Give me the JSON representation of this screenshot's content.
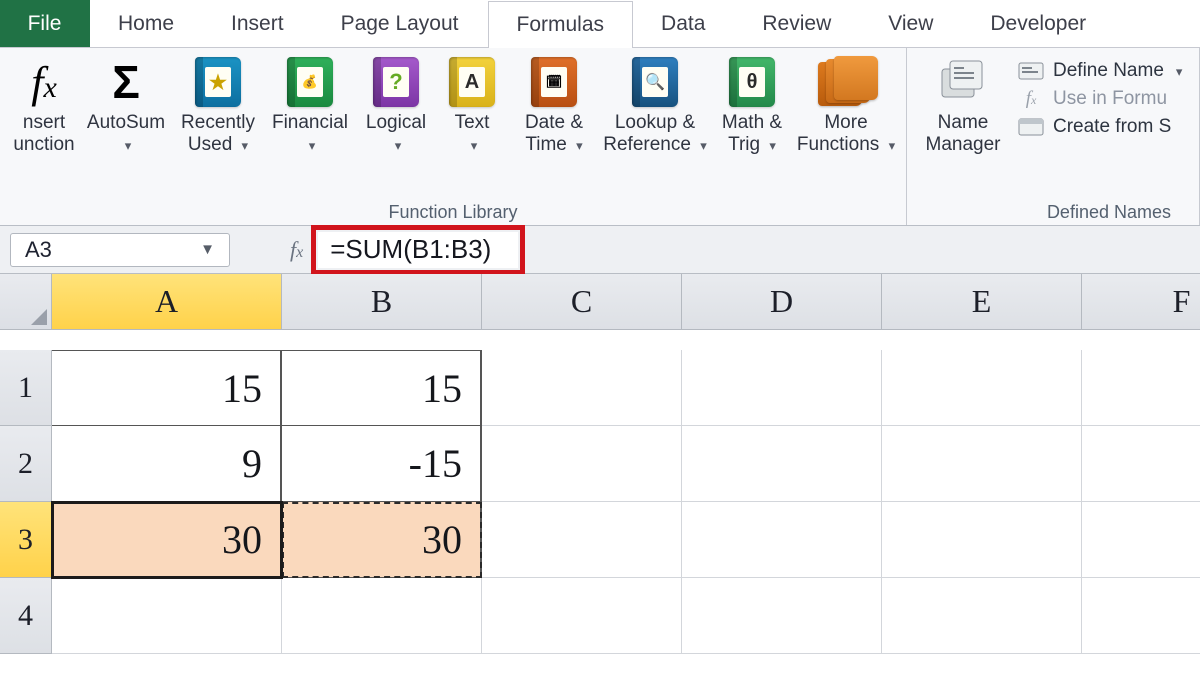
{
  "tabs": {
    "file": "File",
    "home": "Home",
    "insert": "Insert",
    "page_layout": "Page Layout",
    "formulas": "Formulas",
    "data": "Data",
    "review": "Review",
    "view": "View",
    "developer": "Developer"
  },
  "ribbon": {
    "insert_function": {
      "l1": "nsert",
      "l2": "unction"
    },
    "library_label": "Function Library",
    "autosum": "AutoSum",
    "recently_used": {
      "l1": "Recently",
      "l2": "Used"
    },
    "financial": "Financial",
    "logical": "Logical",
    "text": "Text",
    "date_time": {
      "l1": "Date &",
      "l2": "Time"
    },
    "lookup_ref": {
      "l1": "Lookup &",
      "l2": "Reference"
    },
    "math_trig": {
      "l1": "Math &",
      "l2": "Trig"
    },
    "more_fn": {
      "l1": "More",
      "l2": "Functions"
    },
    "name_manager": {
      "l1": "Name",
      "l2": "Manager"
    },
    "defined_names_label": "Defined Names",
    "define_name": "Define Name",
    "use_in_formula": "Use in Formu",
    "create_from": "Create from S"
  },
  "name_box": "A3",
  "formula": "=SUM(B1:B3)",
  "columns": [
    "A",
    "B",
    "C",
    "D",
    "E",
    "F"
  ],
  "rows": [
    "1",
    "2",
    "3",
    "4"
  ],
  "cells": {
    "A1": "15",
    "B1": "15",
    "A2": "9",
    "B2": "-15",
    "A3": "30",
    "B3": "30"
  },
  "selected_col": "A",
  "selected_row": "3"
}
